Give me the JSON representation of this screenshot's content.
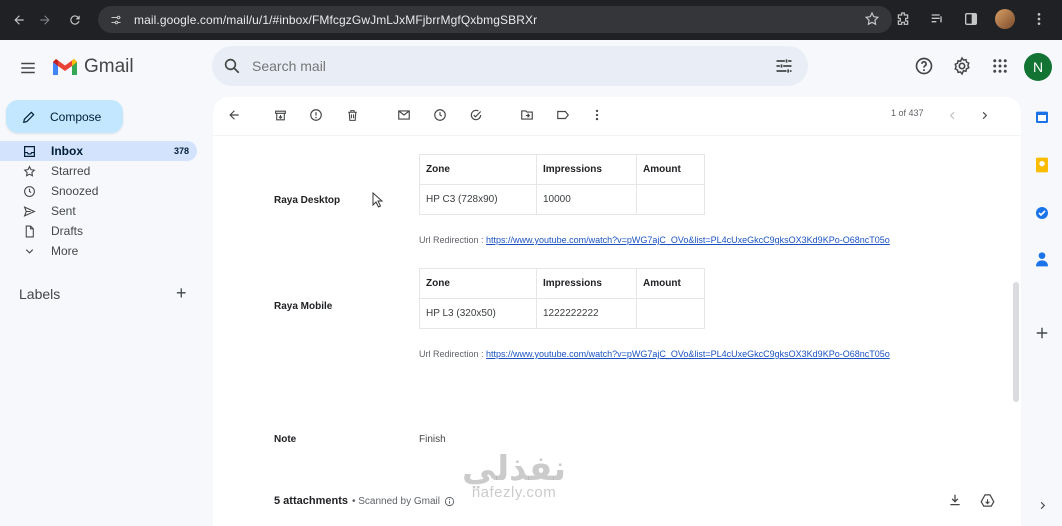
{
  "browser": {
    "url": "mail.google.com/mail/u/1/#inbox/FMfcgzGwJmLJxMFjbrrMgfQxbmgSBRXr"
  },
  "header": {
    "app_name": "Gmail",
    "search_placeholder": "Search mail",
    "avatar_letter": "N"
  },
  "sidebar": {
    "compose_label": "Compose",
    "items": [
      {
        "label": "Inbox",
        "count": "378",
        "icon": "inbox-icon"
      },
      {
        "label": "Starred",
        "count": "",
        "icon": "star-icon"
      },
      {
        "label": "Snoozed",
        "count": "",
        "icon": "clock-icon"
      },
      {
        "label": "Sent",
        "count": "",
        "icon": "send-icon"
      },
      {
        "label": "Drafts",
        "count": "",
        "icon": "draft-icon"
      },
      {
        "label": "More",
        "count": "",
        "icon": "chevron-down-icon"
      }
    ],
    "labels_heading": "Labels",
    "labels_add": "+"
  },
  "toolbar": {
    "pager": "1 of 437"
  },
  "email": {
    "blocks": [
      {
        "label": "Raya Desktop",
        "headers": [
          "Zone",
          "Impressions",
          "Amount"
        ],
        "row": [
          "HP C3 (728x90)",
          "10000",
          ""
        ],
        "url_prefix": "Url Redirection : ",
        "url": "https://www.youtube.com/watch?v=pWG7ajC_OVo&list=PL4cUxeGkcC9gksOX3Kd9KPo-O68ncT05o"
      },
      {
        "label": "Raya Mobile",
        "headers": [
          "Zone",
          "Impressions",
          "Amount"
        ],
        "row": [
          "HP L3 (320x50)",
          "1222222222",
          ""
        ],
        "url_prefix": "Url Redirection : ",
        "url": "https://www.youtube.com/watch?v=pWG7ajC_OVo&list=PL4cUxeGkcC9gksOX3Kd9KPo-O68ncT05o"
      }
    ],
    "note_label": "Note",
    "note_value": "Finish",
    "attachments_count": "5 attachments",
    "scanned_text": "• Scanned by Gmail"
  },
  "watermark": {
    "arabic": "نفذلي",
    "latin": "nafezly.com"
  },
  "colors": {
    "compose_bg": "#c2e7ff",
    "active_nav_bg": "#d3e3fd",
    "link": "#1a52c4",
    "avatar_bg": "#137333"
  }
}
